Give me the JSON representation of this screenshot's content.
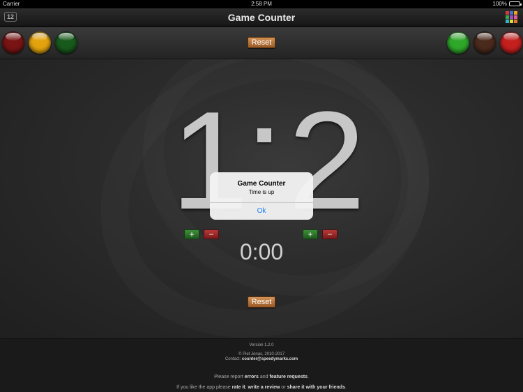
{
  "status_bar": {
    "carrier": "Carrier",
    "time": "2:58 PM",
    "battery": "100%"
  },
  "nav": {
    "title": "Game Counter",
    "left_icon_label": "12",
    "left_icon": "counter-icon",
    "right_icon": "color-grid-icon",
    "grid_colors": [
      "#d23b3b",
      "#4b6fd6",
      "#e6a81f",
      "#3aa64a",
      "#9b4fc2",
      "#e05a9c",
      "#2fb4c9",
      "#e4d83a",
      "#e07a2f"
    ]
  },
  "toolbar": {
    "left_balls": [
      {
        "name": "dark-red",
        "color": "#7a1414"
      },
      {
        "name": "yellow",
        "color": "#e3a30f"
      },
      {
        "name": "dark-green",
        "color": "#185a1c"
      }
    ],
    "right_balls": [
      {
        "name": "green",
        "color": "#2fa82a"
      },
      {
        "name": "brown",
        "color": "#4a2a1c"
      },
      {
        "name": "red",
        "color": "#c4201e"
      }
    ],
    "reset_label": "Reset"
  },
  "score": {
    "left": "1",
    "right": "2"
  },
  "controls": {
    "plus": "+",
    "minus": "−"
  },
  "timer": {
    "value": "0:00",
    "reset_label": "Reset"
  },
  "footer": {
    "version": "Version 1.2.0",
    "copyright": "© Piet Jonas, 2010-2017",
    "contact_label": "Contact:",
    "contact_email": "counter@speedymarks.com",
    "report_pre": "Please report",
    "report_errors": "errors",
    "report_and": "and",
    "report_features": "feature requests",
    "report_end": ".",
    "like_pre": "If you like the app please",
    "like_rate": "rate it",
    "like_comma": ",",
    "like_review": "write a review",
    "like_or": "or",
    "like_share": "share it with your friends",
    "like_end": "."
  },
  "alert": {
    "title": "Game Counter",
    "message": "Time is up",
    "ok_label": "Ok"
  },
  "colors": {
    "accent_orange": "#c17a3e",
    "alert_button_blue": "#1a7cf5",
    "plus_green": "#2e7a2b",
    "minus_red": "#a12727"
  }
}
